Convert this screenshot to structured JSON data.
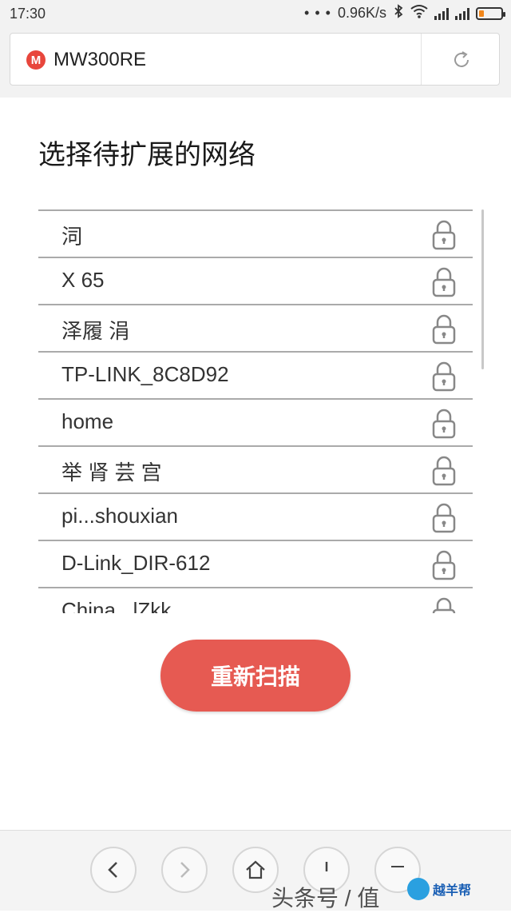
{
  "status_bar": {
    "time": "17:30",
    "dots": "• • •",
    "speed": "0.96K/s"
  },
  "address_bar": {
    "logo_letter": "M",
    "title": "MW300RE"
  },
  "page": {
    "title": "选择待扩展的网络",
    "networks": [
      {
        "name": "泀"
      },
      {
        "name": "X            65"
      },
      {
        "name": "泽履      涓"
      },
      {
        "name": "TP-LINK_8C8D92"
      },
      {
        "name": "home"
      },
      {
        "name": "举 肾 芸 宫"
      },
      {
        "name": "pi...shouxian"
      },
      {
        "name": "D-Link_DIR-612"
      },
      {
        "name": "China...lZkk"
      }
    ],
    "rescan_label": "重新扫描"
  },
  "footer": {
    "watermark": "头条号 / 值",
    "corner_logo_text": "越羊帮"
  },
  "colors": {
    "accent": "#e65a52",
    "logo": "#e8463c",
    "divider": "#aaaaaa"
  }
}
